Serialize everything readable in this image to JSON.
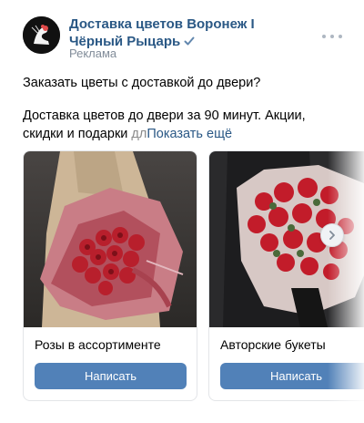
{
  "header": {
    "author": "Доставка цветов Воронеж I Чёрный Рыцарь",
    "ad_label": "Реклама"
  },
  "post": {
    "line1": "Заказать цветы с доставкой до двери?",
    "line2_main": "Доставка цветов до двери за 90 минут. Акции, скидки и подарки ",
    "line2_fade": "дл",
    "show_more": "Показать ещё"
  },
  "carousel": {
    "cards": [
      {
        "title": "Розы в ассортименте",
        "button": "Написать"
      },
      {
        "title": "Авторские букеты",
        "button": "Написать"
      }
    ]
  },
  "icons": {
    "verified": "verified-check-icon",
    "more": "more-dots-icon",
    "next": "chevron-right-icon"
  },
  "colors": {
    "link": "#2a5885",
    "button": "#5181b8",
    "muted": "#818c99"
  }
}
